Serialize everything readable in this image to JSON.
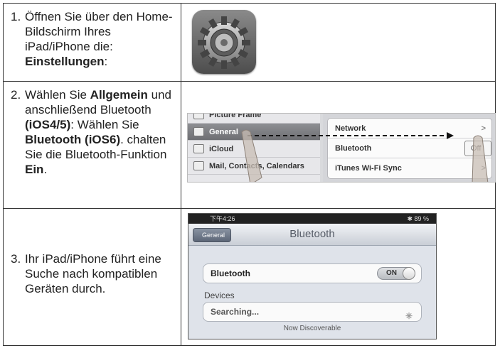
{
  "steps": [
    {
      "num": "1.",
      "parts": {
        "a": "Öffnen Sie über den Home-Bildschirm Ihres iPad/iPhone die: ",
        "b": "Einstellungen",
        "c": ":"
      }
    },
    {
      "num": "2.",
      "parts": {
        "a": "Wählen Sie ",
        "b": "Allgemein",
        "c": " und anschließend Bluetooth ",
        "d": "(iOS4/5)",
        "e": ": Wählen Sie ",
        "f": "Bluetooth (iOS6)",
        "g": ". chalten Sie die Bluetooth-Funktion ",
        "h": "Ein",
        "i": "."
      }
    },
    {
      "num": "3.",
      "parts": {
        "a": "Ihr iPad/iPhone führt eine Suche nach kompatiblen Geräten durch."
      }
    }
  ],
  "settings_icon": {
    "icon": "gear-icon"
  },
  "screen2": {
    "sidebar": [
      {
        "label": "Picture Frame",
        "icon": "picture-frame-icon"
      },
      {
        "label": "General",
        "icon": "gear-icon",
        "selected": true
      },
      {
        "label": "iCloud",
        "icon": "cloud-icon"
      },
      {
        "label": "Mail, Contacts, Calendars",
        "icon": "mail-icon"
      }
    ],
    "detail": [
      {
        "label": "Network",
        "accessory": ">"
      },
      {
        "label": "Bluetooth",
        "accessory": "Off"
      },
      {
        "label": "iTunes Wi-Fi Sync",
        "accessory": ">"
      }
    ]
  },
  "screen3": {
    "status_time": "下午4:26",
    "status_battery": "✱ 89 %",
    "back_label": "General",
    "title": "Bluetooth",
    "bluetooth_label": "Bluetooth",
    "toggle_label": "ON",
    "devices_label": "Devices",
    "searching": "Searching...",
    "discoverable": "Now Discoverable"
  }
}
